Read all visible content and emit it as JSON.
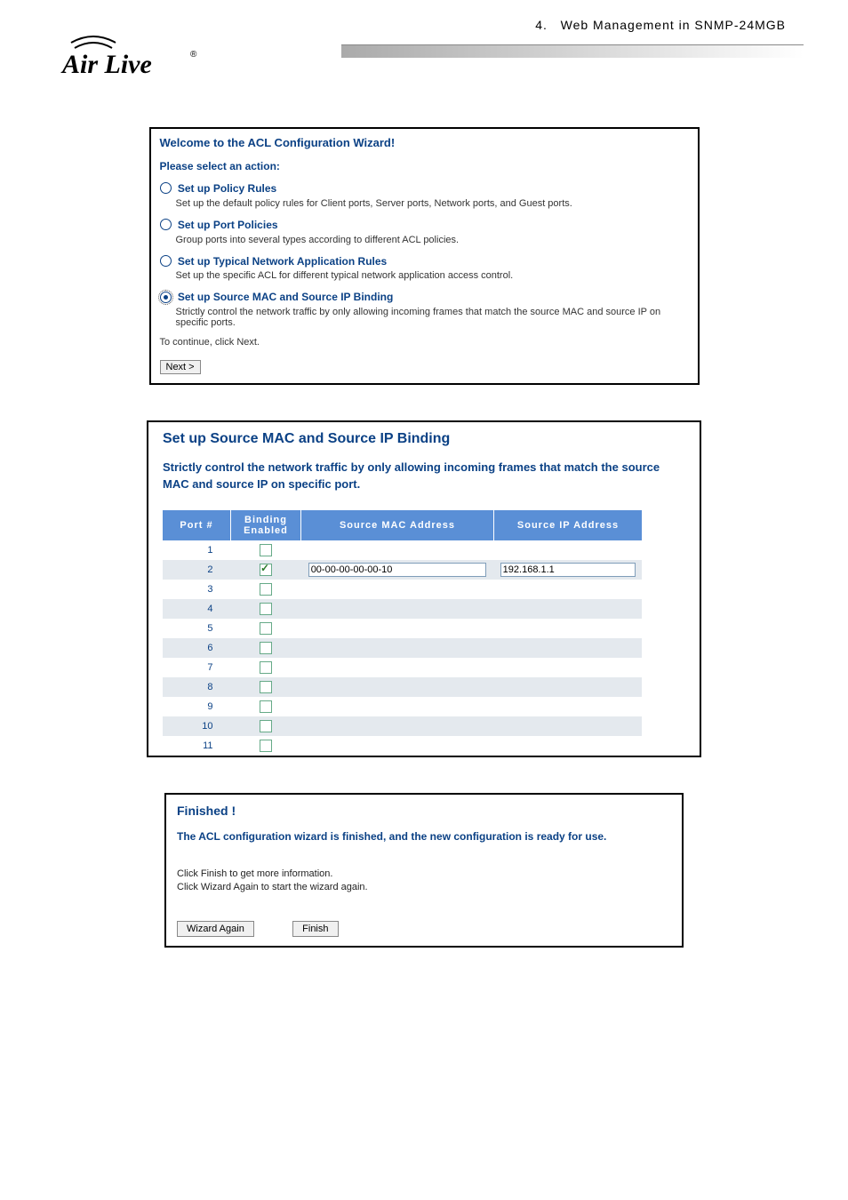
{
  "header": {
    "chapter_num": "4.",
    "chapter_text": "Web Management in SNMP-24MGB",
    "logo_brand": "Air Live",
    "logo_reg": "®"
  },
  "wizard": {
    "title": "Welcome to the ACL Configuration Wizard!",
    "subtitle": "Please select an action:",
    "options": [
      {
        "label": "Set up Policy Rules",
        "desc": "Set up the default policy rules for Client ports, Server ports, Network ports, and Guest ports.",
        "selected": false
      },
      {
        "label": "Set up Port Policies",
        "desc": "Group ports into several types according to different ACL policies.",
        "selected": false
      },
      {
        "label": "Set up Typical Network Application Rules",
        "desc": "Set up the specific ACL for different typical network application access control.",
        "selected": false
      },
      {
        "label": "Set up Source MAC and Source IP Binding",
        "desc": "Strictly control the network traffic by only allowing incoming frames that match the source MAC and source IP on specific ports.",
        "selected": true
      }
    ],
    "continue_text": "To continue, click Next.",
    "next_btn": "Next >"
  },
  "binding": {
    "title": "Set up Source MAC and Source IP Binding",
    "subtitle": "Strictly control the network traffic by only allowing incoming frames that match the source MAC and source IP on specific port.",
    "cols": {
      "port": "Port #",
      "enabled": "Binding Enabled",
      "mac": "Source MAC Address",
      "ip": "Source IP Address"
    },
    "rows": [
      {
        "port": "1",
        "checked": false,
        "mac": "",
        "ip": ""
      },
      {
        "port": "2",
        "checked": true,
        "mac": "00-00-00-00-00-10",
        "ip": "192.168.1.1"
      },
      {
        "port": "3",
        "checked": false,
        "mac": "",
        "ip": ""
      },
      {
        "port": "4",
        "checked": false,
        "mac": "",
        "ip": ""
      },
      {
        "port": "5",
        "checked": false,
        "mac": "",
        "ip": ""
      },
      {
        "port": "6",
        "checked": false,
        "mac": "",
        "ip": ""
      },
      {
        "port": "7",
        "checked": false,
        "mac": "",
        "ip": ""
      },
      {
        "port": "8",
        "checked": false,
        "mac": "",
        "ip": ""
      },
      {
        "port": "9",
        "checked": false,
        "mac": "",
        "ip": ""
      },
      {
        "port": "10",
        "checked": false,
        "mac": "",
        "ip": ""
      },
      {
        "port": "11",
        "checked": false,
        "mac": "",
        "ip": ""
      }
    ]
  },
  "finished": {
    "title": "Finished !",
    "subtitle": "The ACL configuration wizard is finished, and the new configuration is ready for use.",
    "line1": "Click Finish to get more information.",
    "line2": "Click Wizard Again to start the wizard again.",
    "btn_again": "Wizard Again",
    "btn_finish": "Finish"
  }
}
